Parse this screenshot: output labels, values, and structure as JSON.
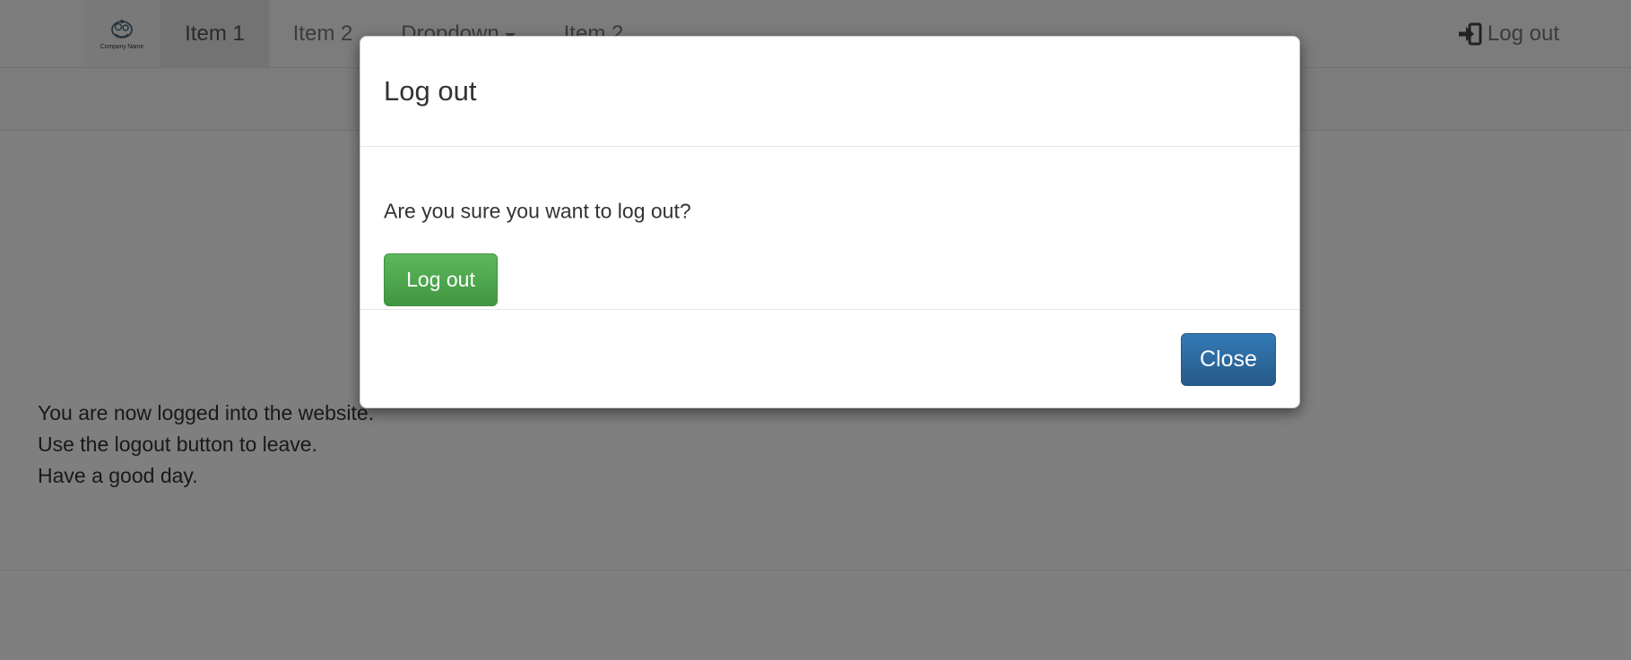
{
  "navbar": {
    "brand": {
      "text": "Company Name",
      "icon": "company-logo"
    },
    "items": [
      {
        "label": "Item 1",
        "active": true
      },
      {
        "label": "Item 2",
        "active": false
      },
      {
        "label": "Dropdown",
        "active": false,
        "icon": "caret-down-icon"
      },
      {
        "label": "Item 2",
        "active": false
      }
    ],
    "logout": {
      "label": "Log out",
      "icon": "log-in-icon"
    }
  },
  "content": {
    "lines": [
      "You are now logged into the website.",
      "Use the logout button to leave.",
      "Have a good day."
    ]
  },
  "modal": {
    "title": "Log out",
    "question": "Are you sure you want to log out?",
    "confirm_label": "Log out",
    "close_label": "Close"
  },
  "colors": {
    "success": "#5cb85c",
    "primary": "#337ab7",
    "backdrop": "rgba(0,0,0,0.5)"
  }
}
